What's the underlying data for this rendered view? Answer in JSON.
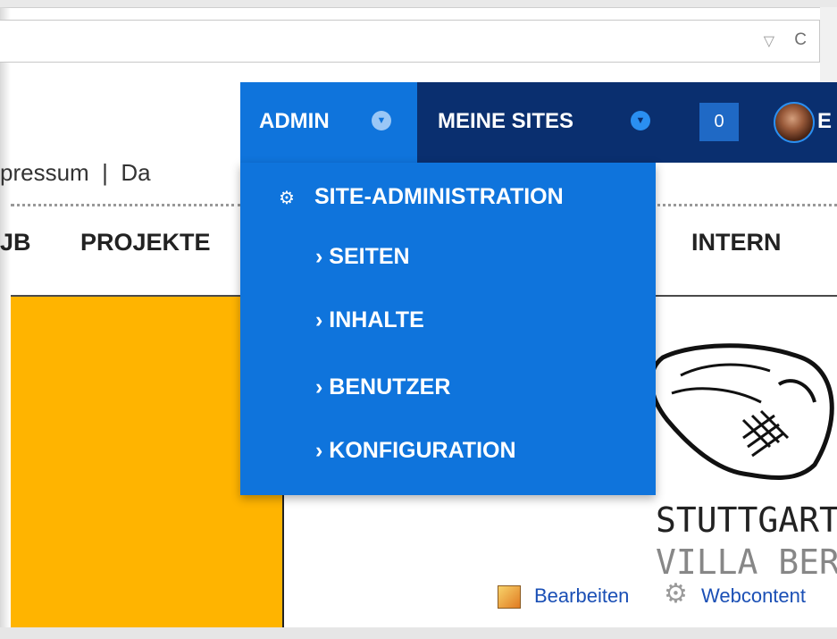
{
  "browser": {
    "dropdown_icon": "▽",
    "reload_icon": "C"
  },
  "dockbar": {
    "admin_label": "ADMIN",
    "admin_caret": "▼",
    "sites_label": "MEINE SITES",
    "sites_caret": "▼",
    "notification_count": "0",
    "user_initial": "E",
    "colors": {
      "admin_blue": "#0f74dc",
      "dark_navy": "#0a2f6f"
    }
  },
  "page": {
    "top_links": "pressum  |  Da",
    "nav_items": [
      "JB",
      "PROJEKTE",
      "INTERN"
    ],
    "logo": {
      "line1": "STUTTGART",
      "line2": "VILLA BERG"
    },
    "edit_label": "Bearbeiten",
    "webcontent_label": "Webcontent",
    "accent_color": "#ffb400"
  },
  "admin_menu": {
    "header_icon": "gear-icon",
    "header": "SITE-ADMINISTRATION",
    "items": [
      "SEITEN",
      "INHALTE",
      "BENUTZER",
      "KONFIGURATION"
    ],
    "item_prefix": "›"
  }
}
